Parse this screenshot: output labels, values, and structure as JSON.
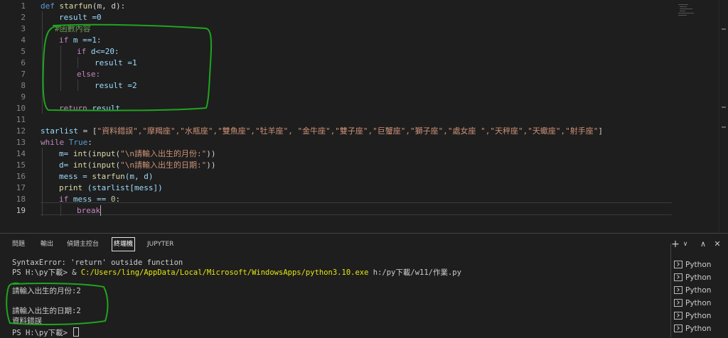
{
  "editor": {
    "line_numbers": [
      "1",
      "2",
      "3",
      "4",
      "5",
      "6",
      "7",
      "8",
      "9",
      "10",
      "11",
      "12",
      "13",
      "14",
      "15",
      "16",
      "17",
      "18",
      "19"
    ],
    "active_line": "19",
    "code": {
      "l1": {
        "kw": "def ",
        "fn": "starfun",
        "rest": "(m, d):"
      },
      "l2": {
        "text": "result =0"
      },
      "l3": {
        "text": "#函數內容"
      },
      "l4": {
        "kw": "if ",
        "rest": "m ==1:"
      },
      "l5": {
        "kw": "if ",
        "rest": "d<=20:"
      },
      "l6": {
        "text": "result =1"
      },
      "l7": {
        "kw": "else:"
      },
      "l8": {
        "text": "result =2"
      },
      "l10": {
        "kw": "return ",
        "rest": "result"
      },
      "l12": {
        "var": "starlist",
        "eq": " = [",
        "strings": "\"資料錯誤\",\"摩羯座\",\"水瓶座\",\"雙魚座\",\"牡羊座\", \"金牛座\",\"雙子座\",\"巨蟹座\",\"獅子座\",\"處女座 \",\"天秤座\",\"天蠍座\",\"射手座\"",
        "close": "]"
      },
      "l13": {
        "kw": "while ",
        "const": "True",
        "colon": ":"
      },
      "l14": {
        "pre": "m= ",
        "f1": "int",
        "p1": "(",
        "f2": "input",
        "p2": "(",
        "str": "\"\\n請輸入出生的月份:\"",
        "end": "))"
      },
      "l15": {
        "pre": "d= ",
        "f1": "int",
        "p1": "(",
        "f2": "input",
        "p2": "(",
        "str": "\"\\n請輸入出生的日期:\"",
        "end": "))"
      },
      "l16": {
        "pre": "mess = ",
        "fn": "starfun",
        "rest": "(m, d)"
      },
      "l17": {
        "fn": "print",
        "rest": " (starlist[mess])"
      },
      "l18": {
        "kw": "if ",
        "rest": "mess == ",
        "num": "0",
        "colon": ":"
      },
      "l19": {
        "kw": "break"
      }
    }
  },
  "panel": {
    "tabs": [
      {
        "label": "問題"
      },
      {
        "label": "輸出"
      },
      {
        "label": "偵錯主控台"
      },
      {
        "label": "終端機"
      },
      {
        "label": "JUPYTER"
      }
    ],
    "active_tab": "終端機",
    "actions": {
      "add": "+",
      "dropdown": "∨",
      "maximize": "∧",
      "close": "✕"
    },
    "terminal": {
      "line1": "SyntaxError: 'return' outside function",
      "line2_prefix": "PS H:\\py下載> & ",
      "line2_path": "C:/Users/ling/AppData/Local/Microsoft/WindowsApps/python3.10.exe",
      "line2_suffix": " h:/py下載/w11/作業.py",
      "line3": "請輸入出生的月份:2",
      "line4": "請輸入出生的日期:2",
      "line5": "資料錯誤",
      "line6": "PS H:\\py下載> "
    },
    "terminal_list": [
      {
        "label": "Python"
      },
      {
        "label": "Python"
      },
      {
        "label": "Python"
      },
      {
        "label": "Python"
      },
      {
        "label": "Python"
      },
      {
        "label": "Python"
      }
    ]
  },
  "colors": {
    "annotation": "#1ea51e",
    "keyword": "#c586c0",
    "function": "#dcdcaa",
    "string": "#ce9178",
    "terminal_path": "#e5e510"
  }
}
